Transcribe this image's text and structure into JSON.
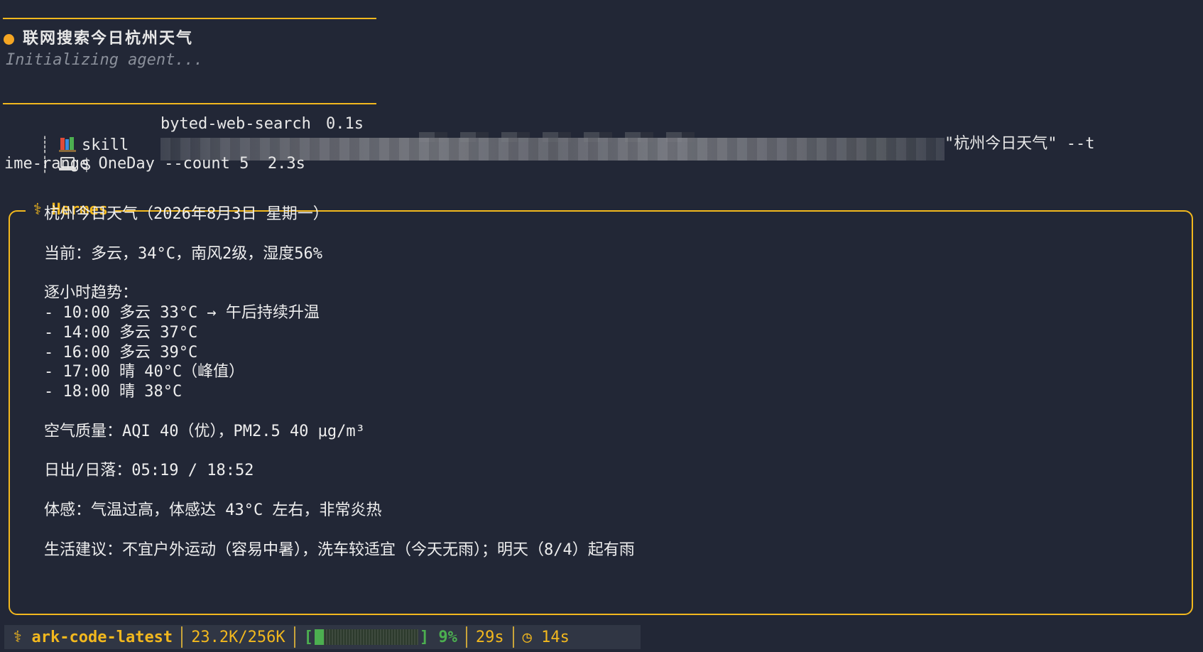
{
  "task": {
    "title": "联网搜索今日杭州天气",
    "status_text": "Initializing agent..."
  },
  "tool_calls": [
    {
      "kind": "skill",
      "icon": "books-icon",
      "name": "byted-web-search",
      "duration": "0.1s"
    },
    {
      "kind": "$",
      "icon": "laptop-icon",
      "command_tail": "\"杭州今日天气\" --t",
      "command_wrap": "ime-range OneDay --count 5",
      "duration": "2.3s"
    }
  ],
  "response": {
    "agent_name": "Hermes",
    "agent_icon": "caduceus-icon",
    "lines": [
      "杭州今日天气（2026年8月3日 星期一）",
      "",
      "当前：多云，34°C，南风2级，湿度56%",
      "",
      "逐小时趋势：",
      "- 10:00 多云 33°C → 午后持续升温",
      "- 14:00 多云 37°C",
      "- 16:00 多云 39°C",
      "- 17:00 晴 40°C（峰值）",
      "- 18:00 晴 38°C",
      "",
      "空气质量：AQI 40（优），PM2.5 40 μg/m³",
      "",
      "日出/日落：05:19 / 18:52",
      "",
      "体感：气温过高，体感达 43°C 左右，非常炎热",
      "",
      "生活建议：不宜户外运动（容易中暑），洗车较适宜（今天无雨）；明天（8/4）起有雨"
    ]
  },
  "status_bar": {
    "model_icon": "caduceus-icon",
    "model": "ark-code-latest",
    "tokens": "23.2K/256K",
    "bar_open": "[",
    "bar_close": "]",
    "context_fraction": 0.09,
    "context_percent": "9%",
    "elapsed": "29s",
    "timer_icon": "clock-icon",
    "timer": "14s"
  },
  "colors": {
    "background": "#222736",
    "accent": "#f2b81e",
    "status_dot": "#f5a623",
    "progress": "#4caf50"
  }
}
